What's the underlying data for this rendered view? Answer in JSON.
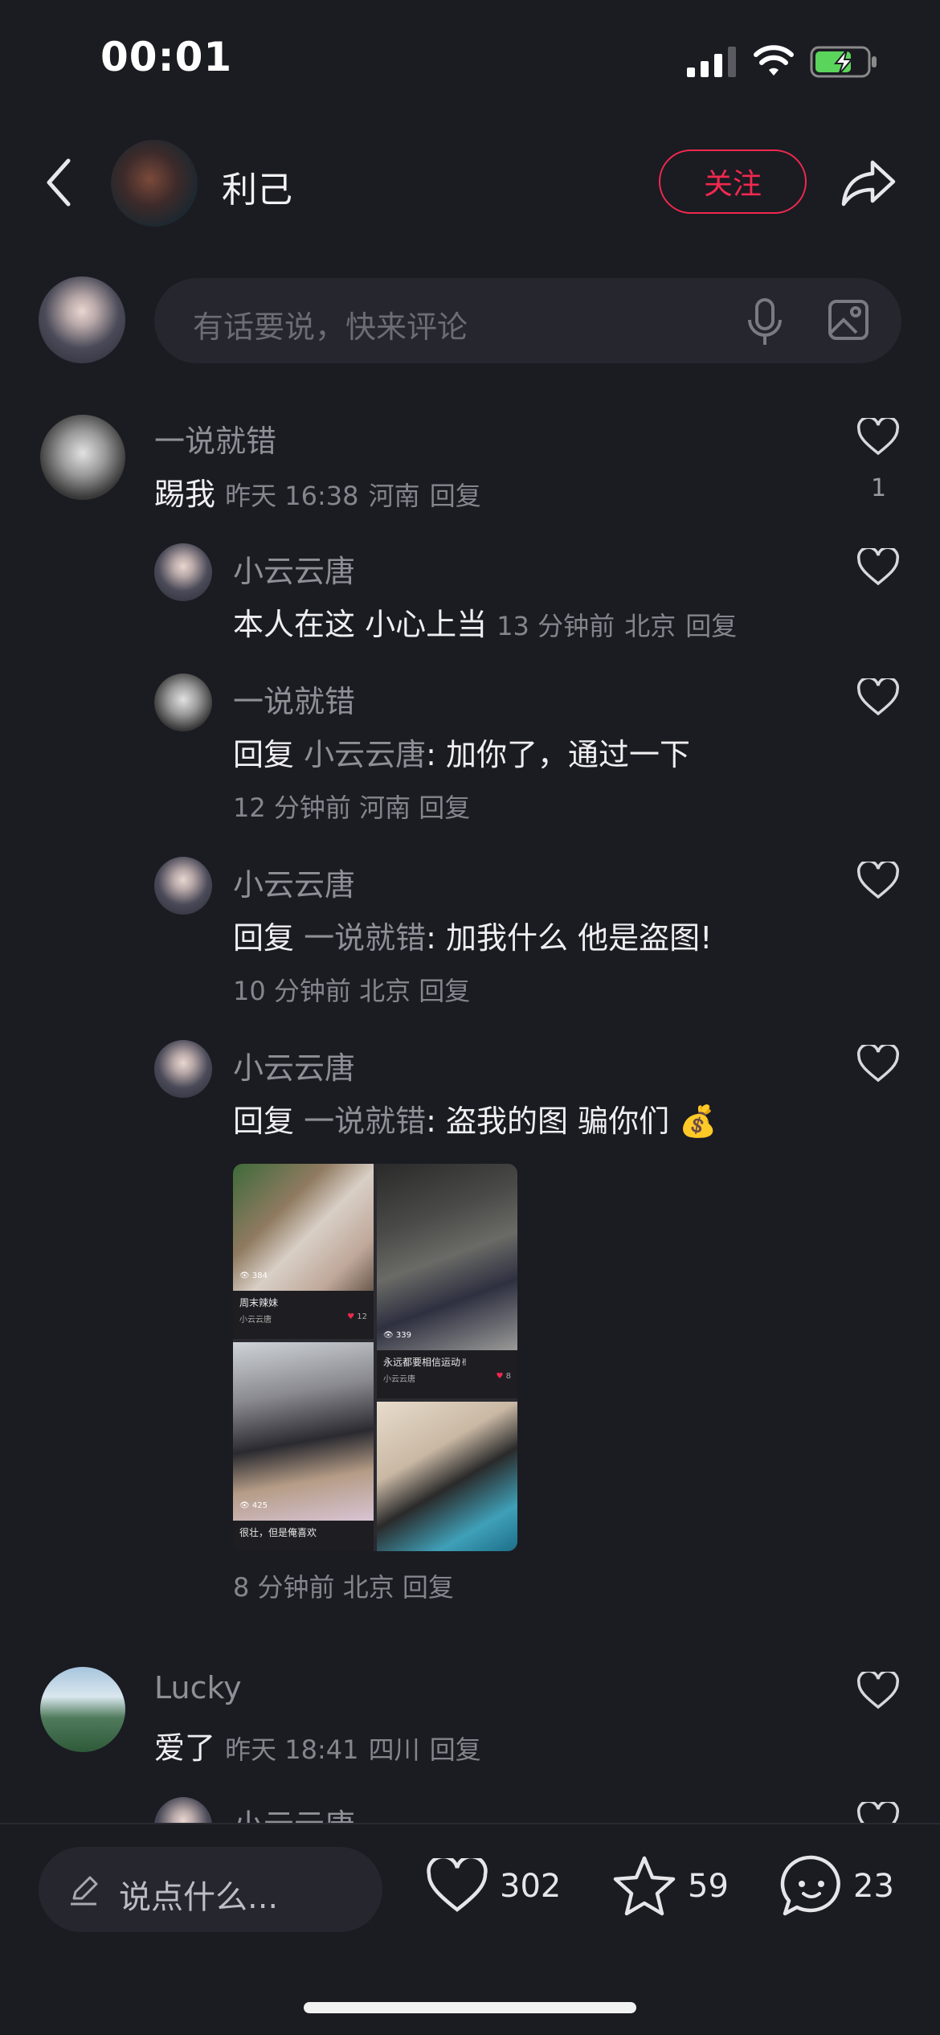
{
  "status_bar": {
    "time": "00:01"
  },
  "header": {
    "username": "利己",
    "follow_label": "关注"
  },
  "comment_input": {
    "placeholder": "有话要说，快来评论"
  },
  "comments": [
    {
      "username": "一说就错",
      "text": "踢我",
      "time": "昨天 16:38",
      "location": "河南",
      "reply_label": "回复",
      "likes": "1",
      "replies": [
        {
          "username": "小云云唐",
          "text": "本人在这 小心上当",
          "time": "13 分钟前",
          "location": "北京",
          "reply_label": "回复"
        },
        {
          "username": "一说就错",
          "prefix": "回复",
          "reply_to": "小云云唐",
          "text": ": 加你了，通过一下",
          "time": "12 分钟前",
          "location": "河南",
          "reply_label": "回复"
        },
        {
          "username": "小云云唐",
          "prefix": "回复",
          "reply_to": "一说就错",
          "text": ": 加我什么 他是盗图!",
          "time": "10 分钟前",
          "location": "北京",
          "reply_label": "回复"
        },
        {
          "username": "小云云唐",
          "prefix": "回复",
          "reply_to": "一说就错",
          "text": ": 盗我的图 骗你们 💰",
          "time": "8 分钟前",
          "location": "北京",
          "reply_label": "回复",
          "image_posts": [
            {
              "views": "384",
              "caption": "周末辣妹",
              "author": "小云云唐",
              "likes": "12"
            },
            {
              "views": "339",
              "caption": "永远都要相信运动✌",
              "author": "小云云唐",
              "likes": "8"
            },
            {
              "views": "425",
              "caption": "很壮，但是俺喜欢"
            }
          ]
        }
      ]
    },
    {
      "username": "Lucky",
      "text": "爱了",
      "time": "昨天 18:41",
      "location": "四川",
      "reply_label": "回复"
    }
  ],
  "partial_next": {
    "username": "小云云唐"
  },
  "bottom_bar": {
    "say_placeholder": "说点什么...",
    "likes": "302",
    "favorites": "59",
    "comments": "23"
  },
  "colors": {
    "background": "#1b1b22",
    "accent": "#f0294e",
    "muted": "#85858d"
  }
}
